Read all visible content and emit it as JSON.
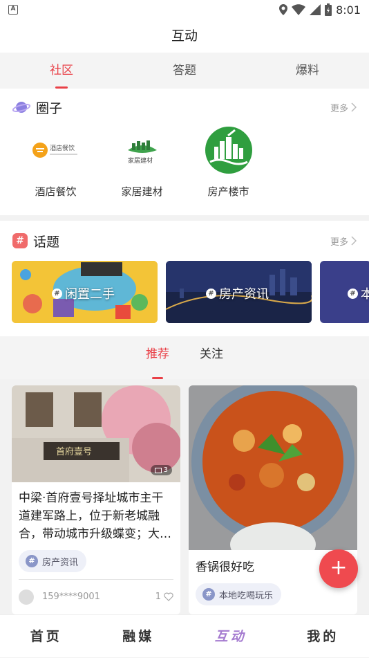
{
  "status": {
    "time": "8:01",
    "left_icon": "A"
  },
  "header": {
    "title": "互动"
  },
  "top_tabs": [
    {
      "label": "社区"
    },
    {
      "label": "答题"
    },
    {
      "label": "爆料"
    }
  ],
  "circles": {
    "title": "圈子",
    "more": "更多",
    "items": [
      {
        "name": "酒店餐饮",
        "logo_text": "酒店餐饮"
      },
      {
        "name": "家居建材",
        "logo_text": "家居建材"
      },
      {
        "name": "房产楼市"
      }
    ]
  },
  "topics": {
    "title": "话题",
    "more": "更多",
    "items": [
      {
        "label": "闲置二手"
      },
      {
        "label": "房产资讯"
      },
      {
        "label": "本"
      }
    ]
  },
  "feed_tabs": [
    {
      "label": "推荐"
    },
    {
      "label": "关注"
    }
  ],
  "cards": [
    {
      "title": "中梁·首府壹号择址城市主干道建军路上，位于新老城融合，带动城市升级蝶变；大…",
      "tag": "房产资讯",
      "user": "159****9001",
      "likes": "1",
      "image_count": "3",
      "sign_text": "首府壹号"
    },
    {
      "title": "香锅很好吃",
      "tag": "本地吃喝玩乐"
    }
  ],
  "fab": {
    "label": "+"
  },
  "bottom_nav": [
    {
      "label": "首页"
    },
    {
      "label": "融媒"
    },
    {
      "label": "互动"
    },
    {
      "label": "我的"
    }
  ],
  "colors": {
    "accent": "#e94047",
    "nav_active": "#a57bd0"
  }
}
